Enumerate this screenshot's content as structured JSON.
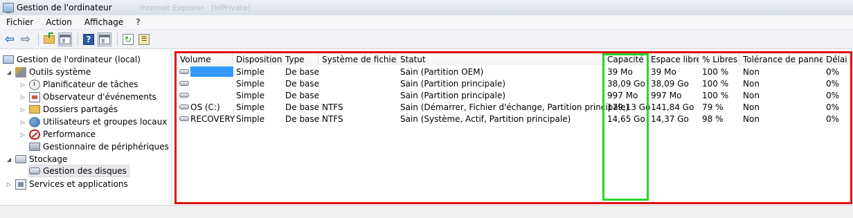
{
  "window": {
    "title": "Gestion de l'ordinateur",
    "ghost_a": "Internet Explorer",
    "ghost_b": "[InPrivate]"
  },
  "menu": [
    "Fichier",
    "Action",
    "Affichage",
    "?"
  ],
  "toolbar": {
    "icons": [
      "back-arrow-icon",
      "forward-arrow-icon",
      "up-folder-icon",
      "show-hide-tree-icon",
      "help-icon",
      "action-pane-icon",
      "refresh-icon",
      "properties-icon"
    ]
  },
  "tree": {
    "root": "Gestion de l'ordinateur (local)",
    "system_tools": "Outils système",
    "task_scheduler": "Planificateur de tâches",
    "event_viewer": "Observateur d'événements",
    "shared_folders": "Dossiers partagés",
    "local_users": "Utilisateurs et groupes locaux",
    "performance": "Performance",
    "device_manager": "Gestionnaire de périphériques",
    "storage": "Stockage",
    "disk_management": "Gestion des disques",
    "services": "Services et applications"
  },
  "table": {
    "headers": [
      "Volume",
      "Disposition",
      "Type",
      "Système de fichiers",
      "Statut",
      "Capacité",
      "Espace libre",
      "% Libres",
      "Tolérance de pannes",
      "Délai"
    ],
    "rows": [
      {
        "volume": "",
        "layout": "Simple",
        "type": "De base",
        "fs": "",
        "status": "Sain (Partition OEM)",
        "capacity": "39 Mo",
        "free": "39 Mo",
        "pct": "100 %",
        "fault": "Non",
        "overhead": "0%"
      },
      {
        "volume": "",
        "layout": "Simple",
        "type": "De base",
        "fs": "",
        "status": "Sain (Partition principale)",
        "capacity": "38,09 Go",
        "free": "38,09 Go",
        "pct": "100 %",
        "fault": "Non",
        "overhead": "0%"
      },
      {
        "volume": "",
        "layout": "Simple",
        "type": "De base",
        "fs": "",
        "status": "Sain (Partition principale)",
        "capacity": "997 Mo",
        "free": "997 Mo",
        "pct": "100 %",
        "fault": "Non",
        "overhead": "0%"
      },
      {
        "volume": "OS (C:)",
        "layout": "Simple",
        "type": "De base",
        "fs": "NTFS",
        "status": "Sain (Démarrer, Fichier d'échange, Partition principale)",
        "capacity": "179,13 Go",
        "free": "141,84 Go",
        "pct": "79 %",
        "fault": "Non",
        "overhead": "0%"
      },
      {
        "volume": "RECOVERY",
        "layout": "Simple",
        "type": "De base",
        "fs": "NTFS",
        "status": "Sain (Système, Actif, Partition principale)",
        "capacity": "14,65 Go",
        "free": "14,37 Go",
        "pct": "98 %",
        "fault": "Non",
        "overhead": "0%"
      }
    ]
  },
  "annotations": {
    "outer_frame_color": "#e01010",
    "capacity_frame_color": "#27d727",
    "selection_color": "#3399ff"
  }
}
